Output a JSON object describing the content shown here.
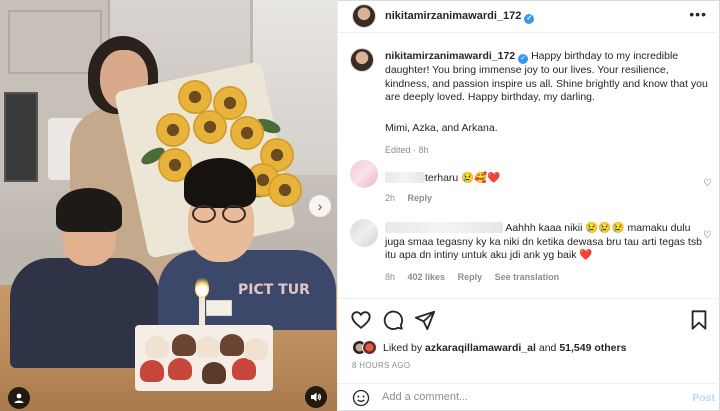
{
  "post": {
    "username": "nikitamirzanimawardi_172",
    "caption": "Happy birthday to my incredible daughter! You bring immense joy to our lives. Your resilience, kindness, and passion inspire us all. Shine brightly and know that you are deeply loved. Happy birthday, my darling.",
    "signature": "Mimi, Azka, and Arkana.",
    "caption_meta": "Edited · 8h",
    "photo_shirt_text": "PICT TUR",
    "icons": {
      "verified": "verified-badge-icon",
      "more": "more-options-icon",
      "next": "chevron-right-icon",
      "user_tag": "user-tag-icon",
      "mute": "volume-icon"
    }
  },
  "comments": [
    {
      "text": "terharu 😢🥰❤️",
      "time": "2h",
      "reply": "Reply"
    },
    {
      "text": "Aahhh kaaa nikii 😢😢😢 mamaku dulu juga smaa tegasny ky ka niki dn ketika dewasa bru tau arti tegas tsb itu apa dn intiny untuk aku jdi ank yg baik ❤️",
      "time": "8h",
      "likes": "402 likes",
      "reply": "Reply",
      "translation": "See translation"
    }
  ],
  "likes": {
    "prefix": "Liked by",
    "user": "azkaraqillamawardi_al",
    "joiner": "and",
    "others": "51,549 others"
  },
  "time_ago": "8 HOURS AGO",
  "add_comment": {
    "placeholder": "Add a comment...",
    "post_label": "Post"
  },
  "colors": {
    "verified": "#3897f0",
    "heart": "#ed4956",
    "post_disabled": "#b3dbff",
    "meta_gray": "#8e8e8e"
  }
}
